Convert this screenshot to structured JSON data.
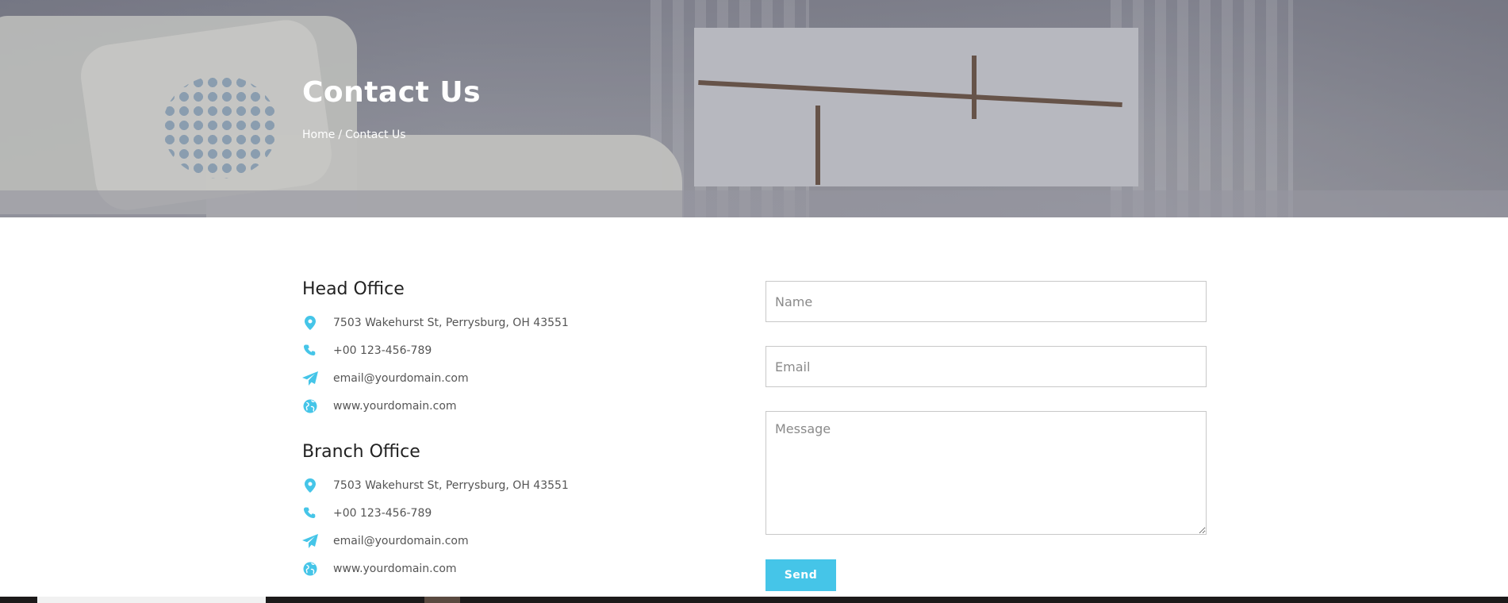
{
  "hero": {
    "title": "Contact Us",
    "breadcrumb": {
      "home": "Home",
      "separator": "/",
      "current": "Contact Us"
    }
  },
  "offices": [
    {
      "title": "Head Office",
      "address": "7503 Wakehurst St, Perrysburg, OH 43551",
      "phone": "+00 123-456-789",
      "email": "email@yourdomain.com",
      "website": "www.yourdomain.com"
    },
    {
      "title": "Branch Office",
      "address": "7503 Wakehurst St, Perrysburg, OH 43551",
      "phone": "+00 123-456-789",
      "email": "email@yourdomain.com",
      "website": "www.yourdomain.com"
    }
  ],
  "icons": {
    "address": "map-pin-icon",
    "phone": "phone-icon",
    "email": "paper-plane-icon",
    "website": "globe-icon"
  },
  "form": {
    "name_placeholder": "Name",
    "email_placeholder": "Email",
    "message_placeholder": "Message",
    "send_label": "Send"
  },
  "colors": {
    "accent": "#45c5e8",
    "heading": "#222222",
    "text": "#555555",
    "white": "#ffffff"
  }
}
